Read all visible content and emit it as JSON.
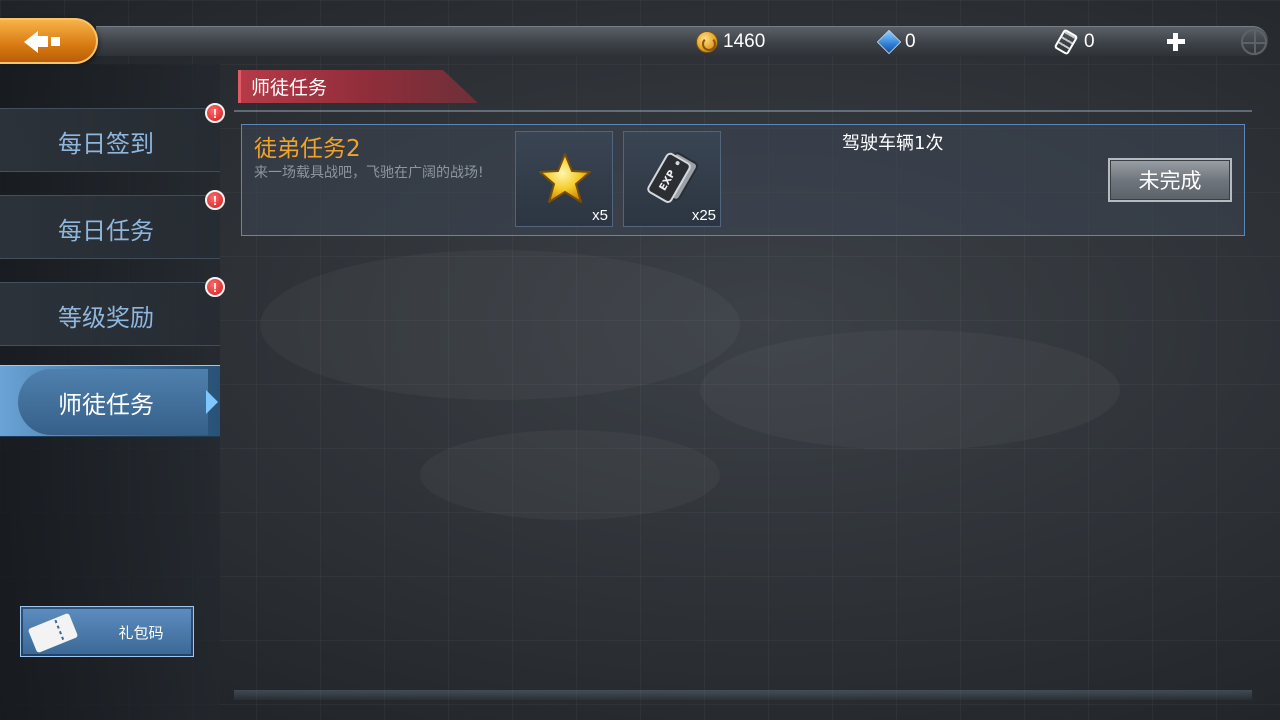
{
  "topbar": {
    "back_icon": "back-arrow-icon",
    "resources": [
      {
        "icon": "coin-icon",
        "value": "1460"
      },
      {
        "icon": "gem-icon",
        "value": "0"
      },
      {
        "icon": "ticket-icon",
        "value": "0"
      }
    ],
    "plus_icon": "plus-icon",
    "crosshair_icon": "crosshair-icon"
  },
  "sidebar": {
    "items": [
      {
        "label": "每日签到",
        "alert": "!"
      },
      {
        "label": "每日任务",
        "alert": "!"
      },
      {
        "label": "等级奖励",
        "alert": "!"
      },
      {
        "label": "师徒任务",
        "active": true
      }
    ],
    "gift_code_label": "礼包码"
  },
  "main": {
    "section_title": "师徒任务",
    "task": {
      "title": "徒弟任务2",
      "description": "来一场载具战吧，飞驰在广阔的战场!",
      "rewards": [
        {
          "icon": "star-icon",
          "count": "x5"
        },
        {
          "icon": "exp-card-icon",
          "count": "x25"
        }
      ],
      "requirement": "驾驶车辆1次",
      "status": "未完成"
    }
  },
  "colors": {
    "task_title": "#f0a32c",
    "active_tab": "#4f80ad",
    "section_tab": "#b53a48",
    "back_button": "#d97a12"
  }
}
